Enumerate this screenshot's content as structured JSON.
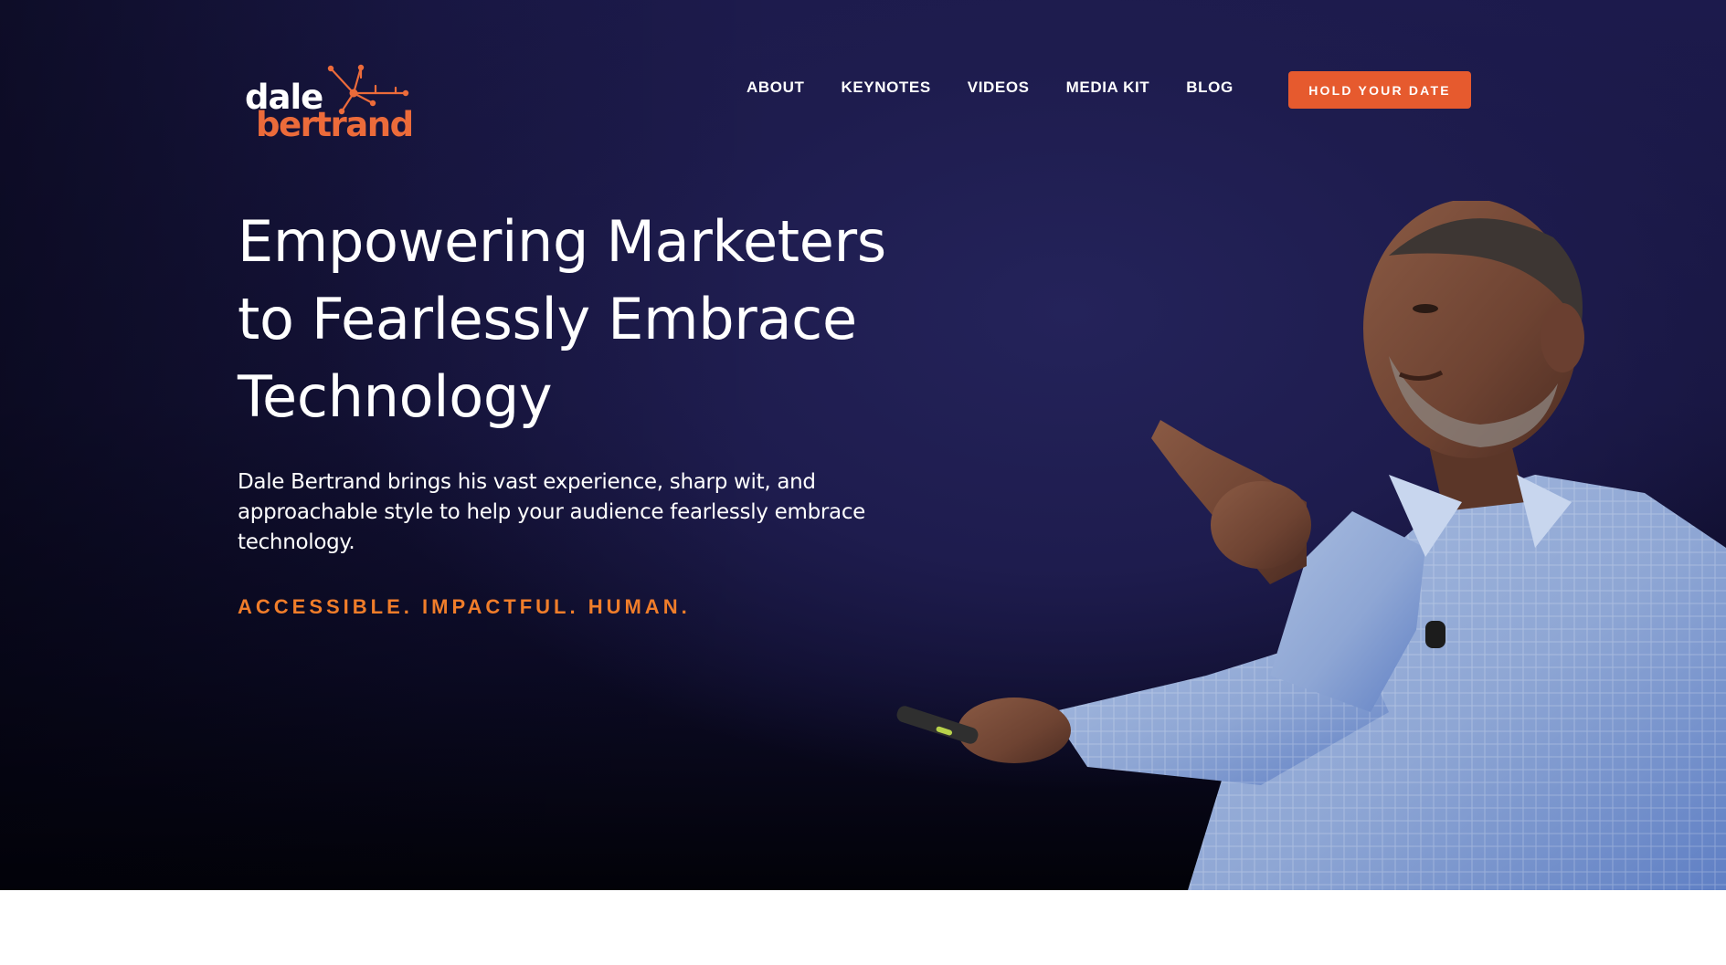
{
  "logo": {
    "line1": "dale",
    "line2": "bertrand"
  },
  "nav": {
    "items": [
      {
        "label": "ABOUT"
      },
      {
        "label": "KEYNOTES"
      },
      {
        "label": "VIDEOS"
      },
      {
        "label": "MEDIA KIT"
      },
      {
        "label": "BLOG"
      }
    ],
    "cta_label": "HOLD YOUR DATE"
  },
  "hero": {
    "headline_lines": [
      "Empowering Marketers",
      "to Fearlessly Embrace",
      "Technology"
    ],
    "subtext_lines": [
      "Dale Bertrand brings his vast experience, sharp wit, and",
      "approachable style to help your audience fearlessly embrace",
      "technology."
    ],
    "tagline": "ACCESSIBLE. IMPACTFUL. HUMAN."
  },
  "colors": {
    "brand_orange": "#ec6b3a",
    "cta_background": "#e65a2e",
    "tagline": "#f07d2a",
    "hero_background": "#1c1a4c"
  },
  "icons": {
    "logo_mark": "network-node-icon"
  }
}
